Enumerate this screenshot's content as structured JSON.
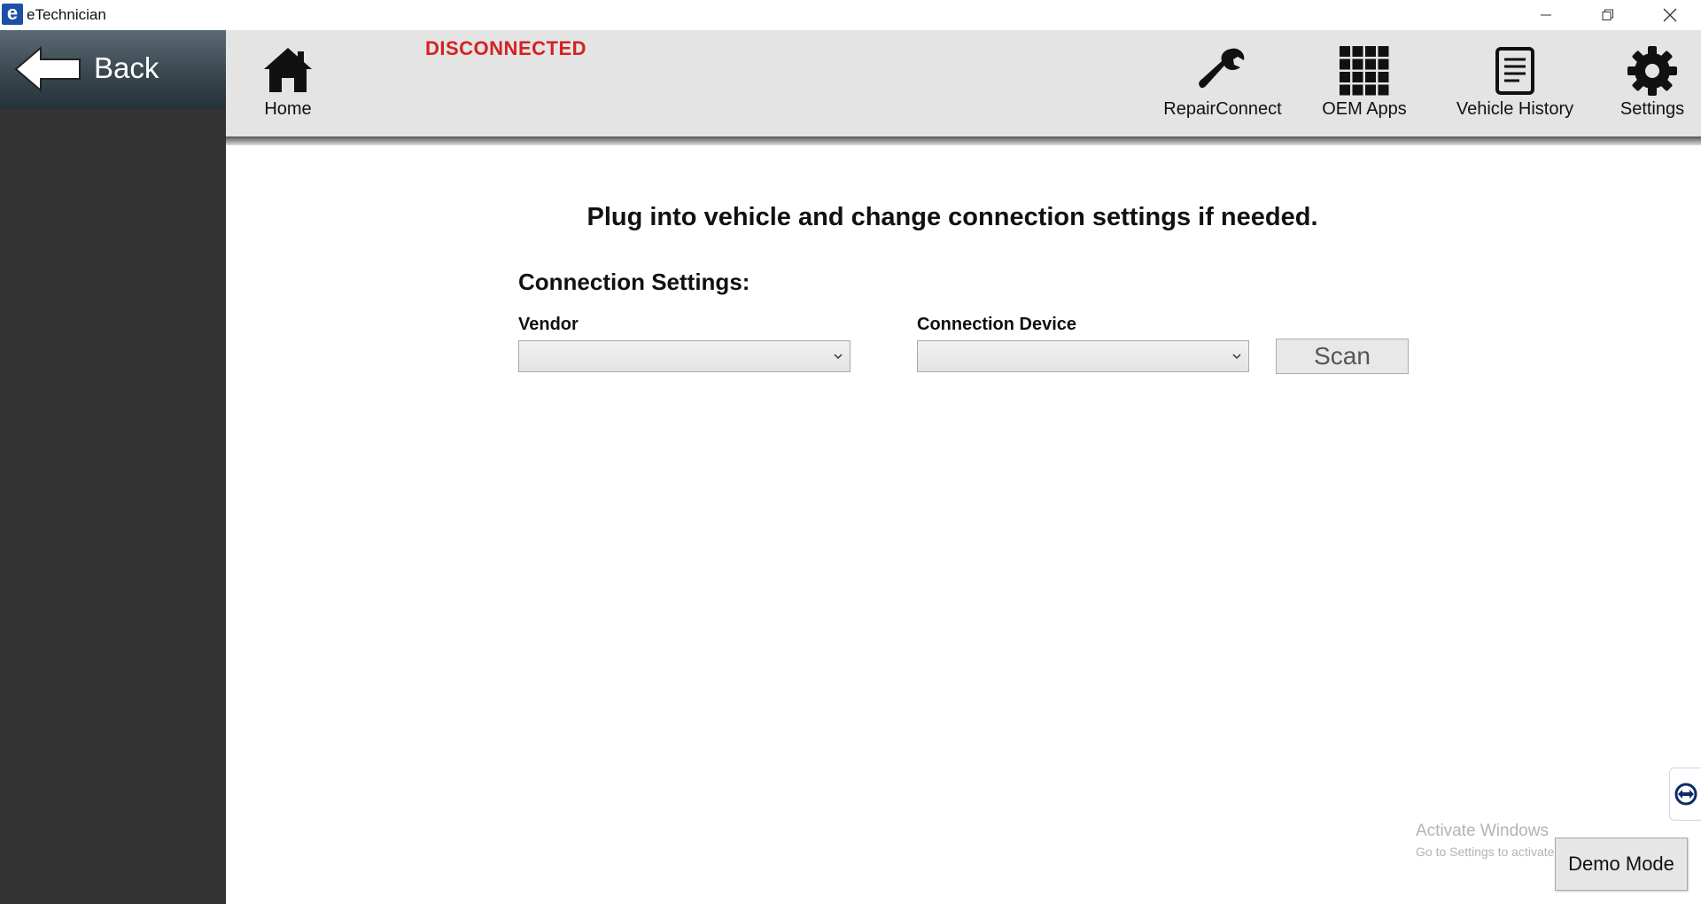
{
  "window": {
    "app_icon_letter": "e",
    "title": "eTechnician"
  },
  "sidebar": {
    "back_label": "Back"
  },
  "nav": {
    "status": "DISCONNECTED",
    "status_color": "#d42222",
    "items": [
      {
        "label": "Home",
        "icon": "home-icon"
      },
      {
        "label": "RepairConnect",
        "icon": "wrench-icon"
      },
      {
        "label": "OEM Apps",
        "icon": "grid-icon"
      },
      {
        "label": "Vehicle History",
        "icon": "document-icon"
      },
      {
        "label": "Settings",
        "icon": "gear-icon"
      }
    ]
  },
  "main": {
    "instruction": "Plug into vehicle and change connection settings if needed.",
    "connection_heading": "Connection Settings:",
    "vendor_label": "Vendor",
    "vendor_value": "",
    "device_label": "Connection Device",
    "device_value": "",
    "scan_label": "Scan"
  },
  "footer": {
    "watermark_title": "Activate Windows",
    "watermark_sub": "Go to Settings to activate Windows.",
    "demo_label": "Demo Mode",
    "teamviewer_icon": "teamviewer-icon"
  }
}
